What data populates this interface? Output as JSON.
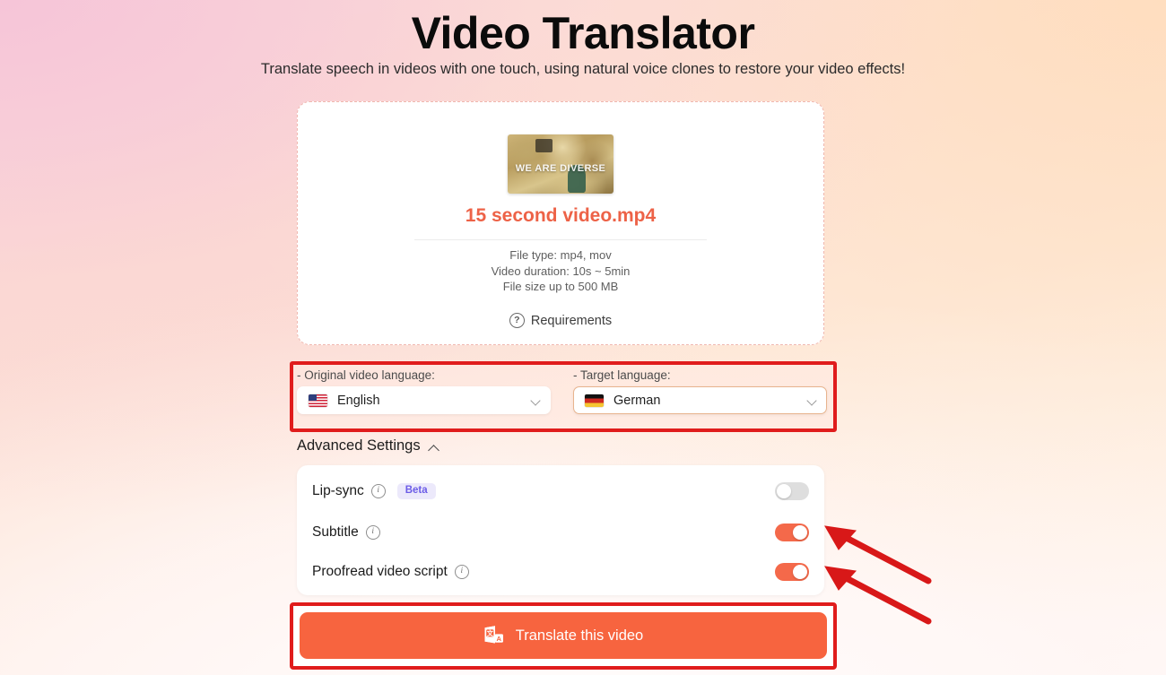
{
  "header": {
    "title": "Video Translator",
    "subtitle": "Translate speech in videos with one touch, using natural voice clones to restore your video effects!"
  },
  "upload": {
    "thumbnail_caption": "WE ARE DIVERSE",
    "file_name": "15 second video.mp4",
    "meta_line_1": "File type: mp4, mov",
    "meta_line_2": "Video duration: 10s ~ 5min",
    "meta_line_3": "File size up to 500 MB",
    "requirements_label": "Requirements",
    "requirements_icon": "question-circle-icon"
  },
  "languages": {
    "source": {
      "label": "- Original video language:",
      "value": "English",
      "flag": "flag-us-icon"
    },
    "target": {
      "label": "- Target language:",
      "value": "German",
      "flag": "flag-de-icon"
    },
    "chevron_icon": "chevron-down-icon"
  },
  "advanced": {
    "title": "Advanced Settings",
    "collapse_icon": "chevron-up-icon",
    "options": [
      {
        "label": "Lip-sync",
        "info_icon": "info-icon",
        "badge": "Beta",
        "toggle_on": false
      },
      {
        "label": "Subtitle",
        "info_icon": "info-icon",
        "badge": null,
        "toggle_on": true
      },
      {
        "label": "Proofread video script",
        "info_icon": "info-icon",
        "badge": null,
        "toggle_on": true
      }
    ]
  },
  "action": {
    "button_label": "Translate this video",
    "button_icon": "translate-icon"
  },
  "annotations": {
    "highlight_color": "#e01c1c",
    "arrow_color": "#d81818",
    "arrow_count": 2
  },
  "colors": {
    "accent_orange": "#f7643f",
    "file_name_orange": "#ed6247",
    "toggle_on": "#f4694a",
    "toggle_off": "#dedede",
    "beta_badge_bg": "#ece9fb",
    "beta_badge_text": "#6c5ce7"
  }
}
